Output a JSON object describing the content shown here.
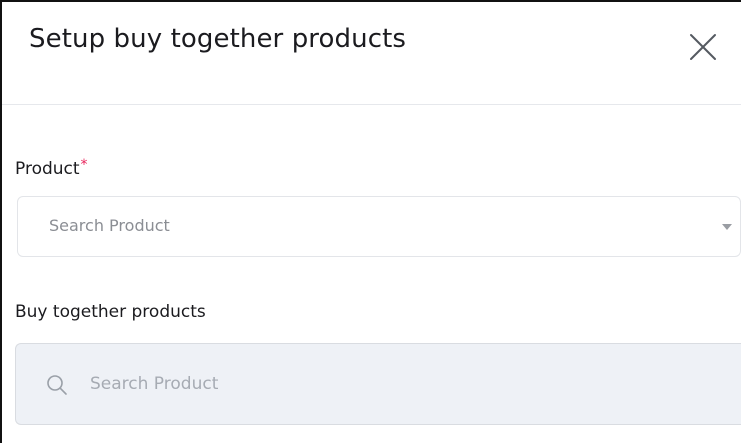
{
  "dialog": {
    "title": "Setup buy together products",
    "close_icon": "close-icon"
  },
  "product_field": {
    "label": "Product",
    "required_marker": "*",
    "required_color": "#e8245b",
    "placeholder": "Search Product",
    "dropdown_icon": "caret-down-icon"
  },
  "buy_together_field": {
    "label": "Buy together products",
    "placeholder": "Search Product",
    "value": "",
    "search_icon": "search-icon",
    "background_color": "#eef1f6"
  }
}
